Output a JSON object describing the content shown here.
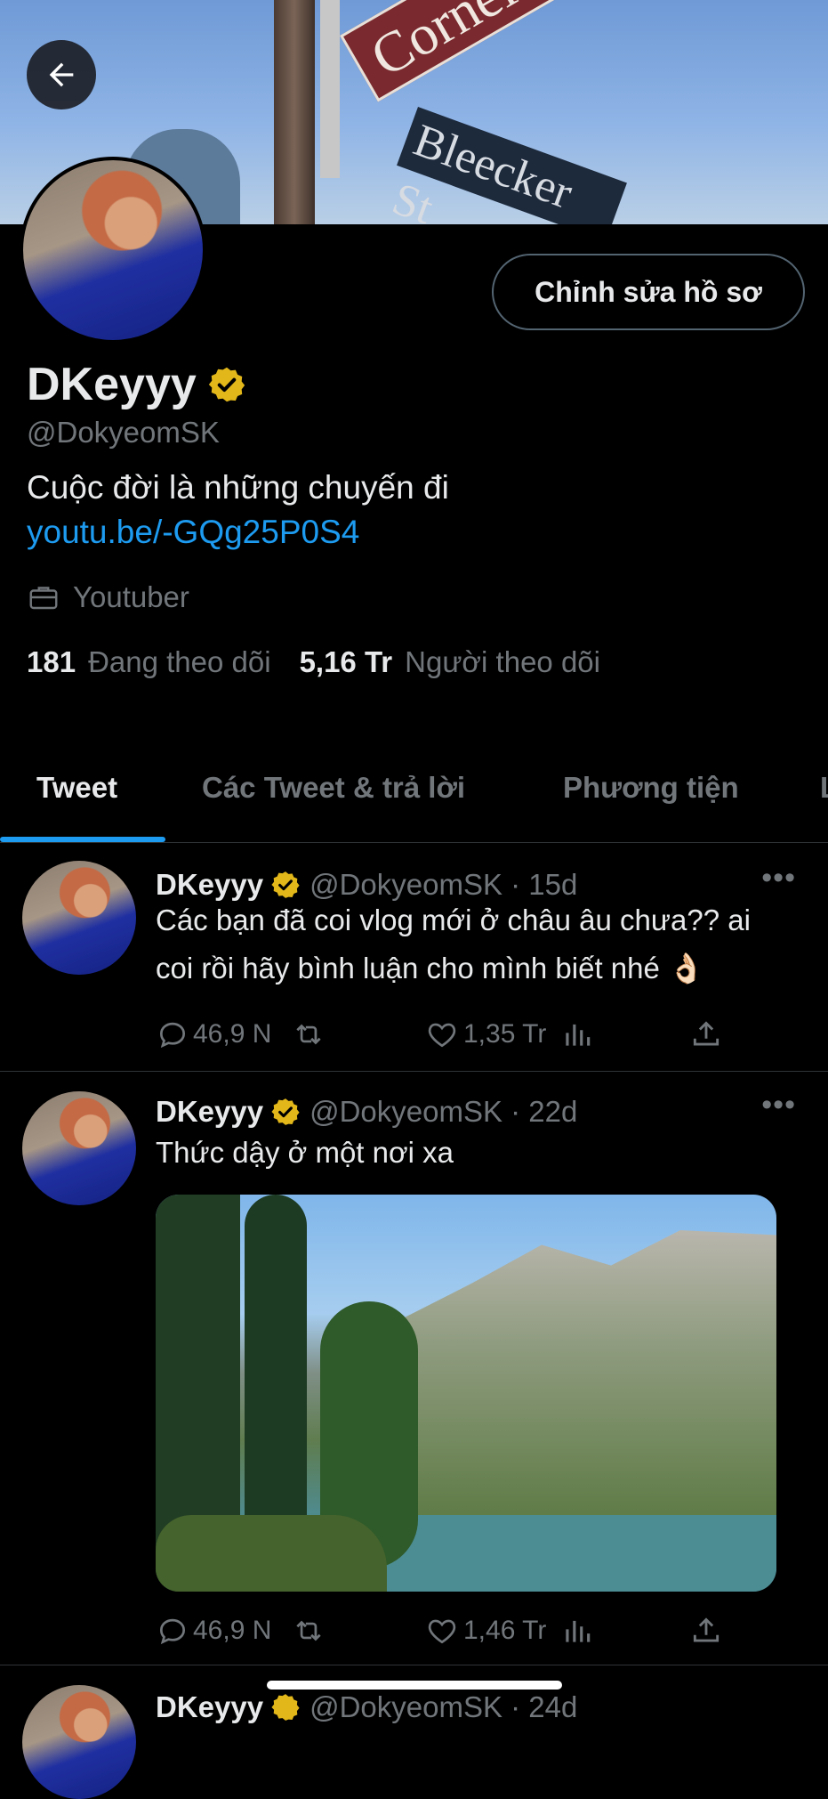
{
  "banner": {
    "sign_top": "Cornelia St",
    "sign_bottom": "Bleecker St"
  },
  "header": {
    "back_icon": "arrow-left-icon"
  },
  "profile": {
    "edit_button": "Chỉnh sửa hồ sơ",
    "name": "DKeyyy",
    "handle": "@DokyeomSK",
    "bio": "Cuộc đời là những chuyến đi",
    "link": "youtu.be/-GQg25P0S4",
    "job": "Youtuber",
    "following_count": "181",
    "following_label": "Đang theo dõi",
    "followers_count": "5,16 Tr",
    "followers_label": "Người theo dõi",
    "verified_color": "#e2b719",
    "link_color": "#1d9bf0"
  },
  "tabs": [
    "Tweet",
    "Các Tweet & trả lời",
    "Phương tiện",
    "L"
  ],
  "tweets": [
    {
      "name": "DKeyyy",
      "handle": "@DokyeomSK · 15d",
      "text": "Các bạn đã coi vlog mới ở châu âu chưa?? ai coi rồi hãy bình luận cho mình biết nhé 👌🏻",
      "replies": "46,9 N",
      "likes": "1,35 Tr"
    },
    {
      "name": "DKeyyy",
      "handle": "@DokyeomSK · 22d",
      "text": "Thức dậy ở một nơi xa",
      "replies": "46,9 N",
      "likes": "1,46 Tr"
    },
    {
      "name": "DKeyyy",
      "handle": "@DokyeomSK · 24d"
    }
  ]
}
